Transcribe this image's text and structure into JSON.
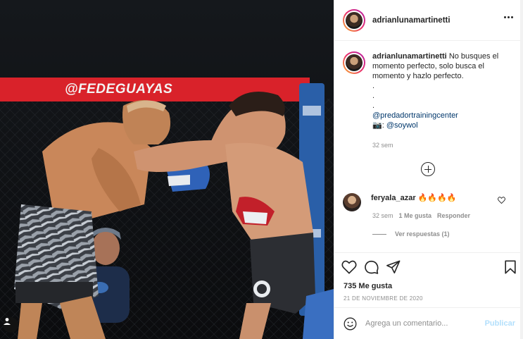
{
  "photo": {
    "banner_text": "@FEDEGUAYAS",
    "alt": ""
  },
  "header": {
    "username": "adrianlunamartinetti"
  },
  "caption": {
    "username": "adrianlunamartinetti",
    "text": "No busques el momento perfecto, solo busca el momento y hazlo perfecto.",
    "dots": [
      ".",
      ".",
      "."
    ],
    "mention1": "@predadortrainingcenter",
    "camera_prefix": "📷: ",
    "mention2": "@soywol",
    "time": "32 sem"
  },
  "comment": {
    "username": "feryala_azar",
    "text": "🔥🔥🔥🔥",
    "time": "32 sem",
    "likes": "1 Me gusta",
    "reply": "Responder",
    "view_replies": "Ver respuestas (1)"
  },
  "actions": {
    "likes": "735 Me gusta",
    "date": "21 DE NOVIEMBRE DE 2020"
  },
  "add_comment": {
    "placeholder": "Agrega un comentario...",
    "post_label": "Publicar"
  },
  "icons": {
    "more": "more-horizontal-icon",
    "add": "plus-circle-icon",
    "heart": "heart-icon",
    "comment": "comment-icon",
    "share": "share-icon",
    "save": "bookmark-icon",
    "emoji": "emoji-icon",
    "user_tag": "user-tag-icon"
  }
}
